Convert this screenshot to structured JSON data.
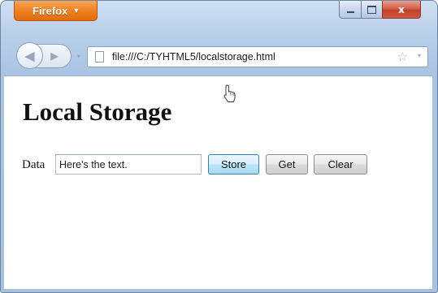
{
  "browser": {
    "menu_label": "Firefox",
    "window_controls": {
      "minimize": "minimize",
      "maximize": "maximize",
      "close": "x"
    },
    "navigation": {
      "back_glyph": "◀",
      "forward_glyph": "▶",
      "history_glyph": "▾",
      "url": "file:///C:/TYHTML5/localstorage.html",
      "bookmark_glyph": "☆",
      "url_dropdown_glyph": "▾"
    }
  },
  "page": {
    "title": "Local Storage",
    "form": {
      "label": "Data",
      "input_value": "Here's the text.",
      "buttons": {
        "store": "Store",
        "get": "Get",
        "clear": "Clear"
      }
    }
  },
  "colors": {
    "firefox_orange": "#ef7f1e",
    "window_frame": "#b9d0ea",
    "close_red": "#c2402a",
    "hover_blue": "#3c7fb1"
  },
  "icons": [
    "firefox-menu-caret",
    "back-arrow-icon",
    "forward-arrow-icon",
    "page-icon",
    "star-icon",
    "mouse-cursor-icon"
  ]
}
